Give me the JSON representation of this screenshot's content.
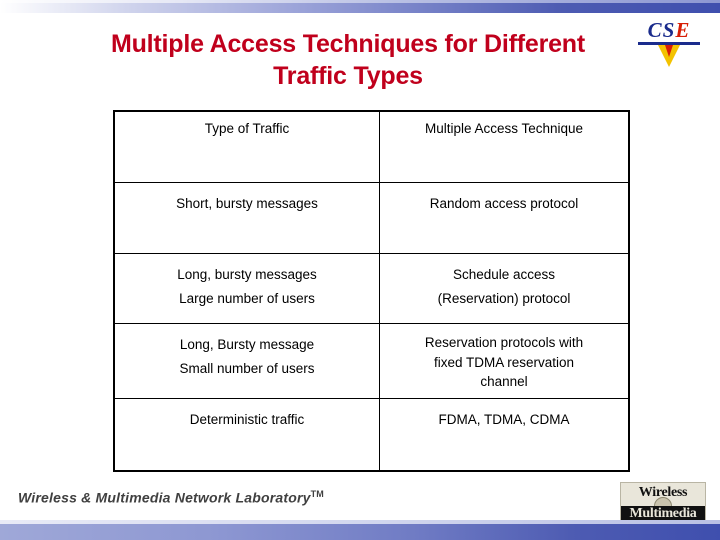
{
  "slide": {
    "title_line1": "Multiple Access Techniques for Different",
    "title_line2": "Traffic Types",
    "title_color": "#c0001c"
  },
  "logo_top": {
    "text_cs": "CS",
    "text_e": "E",
    "name": "cse-logo"
  },
  "table": {
    "headers": {
      "col1": "Type of Traffic",
      "col2": "Multiple Access Technique"
    },
    "rows": [
      {
        "traffic": [
          "Short, bursty messages"
        ],
        "technique": [
          "Random access protocol"
        ]
      },
      {
        "traffic": [
          "Long, bursty messages",
          "Large number of users"
        ],
        "technique": [
          "Schedule access",
          "(Reservation) protocol"
        ]
      },
      {
        "traffic": [
          "Long, Bursty message",
          "Small number of users"
        ],
        "technique": [
          "Reservation protocols with",
          "fixed TDMA reservation",
          "channel"
        ]
      },
      {
        "traffic": [
          "Deterministic traffic"
        ],
        "technique": [
          "FDMA, TDMA, CDMA"
        ]
      }
    ]
  },
  "footer": {
    "lab_name": "Wireless & Multimedia Network Laboratory",
    "trademark": "TM",
    "logo_top_text": "Wireless",
    "logo_bottom_text": "Multimedia"
  }
}
